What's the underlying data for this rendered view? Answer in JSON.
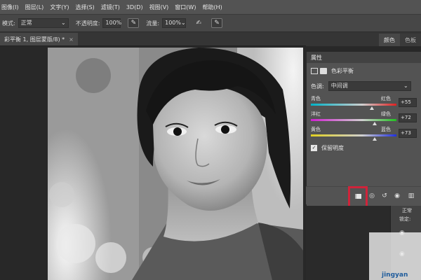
{
  "menu": [
    "图像(I)",
    "图层(L)",
    "文字(Y)",
    "选择(S)",
    "滤镜(T)",
    "3D(D)",
    "视图(V)",
    "窗口(W)",
    "帮助(H)"
  ],
  "options": {
    "mode_label": "模式:",
    "mode_value": "正常",
    "opacity_label": "不透明度:",
    "opacity_value": "100%",
    "flow_label": "流量:",
    "flow_value": "100%"
  },
  "doc_tab": {
    "label": "彩平衡 1, 图层蒙版/8) *",
    "close": "×"
  },
  "panel_tabs": [
    "颜色",
    "色板"
  ],
  "properties": {
    "header": "属性",
    "adjust_name": "色彩平衡",
    "tone_label": "色调:",
    "tone_value": "中间调",
    "sliders": [
      {
        "left": "青色",
        "right": "红色",
        "value": "+55",
        "fraction": 0.72
      },
      {
        "left": "洋红",
        "right": "绿色",
        "value": "+72",
        "fraction": 0.76
      },
      {
        "left": "黄色",
        "right": "蓝色",
        "value": "+73",
        "fraction": 0.76
      }
    ],
    "preserve_label": "保留明度",
    "preserve_checked": true
  },
  "icons": [
    "clip-to-layer-icon",
    "view-previous-icon",
    "reset-icon",
    "visibility-icon",
    "trash-icon"
  ],
  "layers_panel": {
    "top_label": "正常",
    "lock_label": "锁定:"
  },
  "watermark": {
    "text": "jingyan"
  }
}
